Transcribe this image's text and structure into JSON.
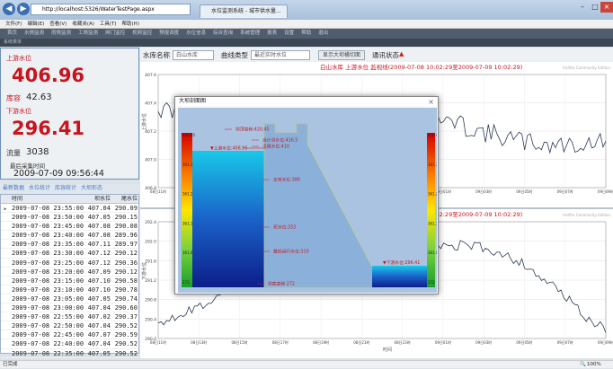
{
  "browser": {
    "address": "http://localhost:5326/WaterTestPage.aspx",
    "tab_label": "水位监测系统 - 城市供水量...",
    "back": "◀",
    "forward": "▶",
    "menu": [
      "文件(F)",
      "编辑(E)",
      "查看(V)",
      "收藏夹(A)",
      "工具(T)",
      "帮助(H)"
    ]
  },
  "app": {
    "nav": [
      "首页",
      "水情监测",
      "雨情监测",
      "工情监测",
      "闸门监控",
      "视频监控",
      "预报调度",
      "水位信息",
      "综合查询",
      "系统管理",
      "报表",
      "设置",
      "帮助",
      "退出"
    ],
    "subtitle": "系统菜单"
  },
  "left": {
    "upstream_label": "上游水位",
    "upstream_value": "406.96",
    "storage_label": "库容",
    "storage_value": "42.63",
    "downstream_label": "下游水位",
    "downstream_value": "296.41",
    "flow_label": "流量",
    "flow_value": "3038",
    "last_time_label": "最后采集时间",
    "last_time_value": "2009-07-09 09:56:44"
  },
  "table": {
    "tabs": [
      "最新数据",
      "水位统计",
      "库容统计",
      "大坝形态"
    ],
    "headers": [
      "时间",
      "坝水位",
      "尾水位"
    ],
    "rows": [
      [
        "2009-07-08 23:55:00",
        "407.04",
        "290.09"
      ],
      [
        "2009-07-08 23:50:00",
        "407.05",
        "290.15"
      ],
      [
        "2009-07-08 23:45:00",
        "407.08",
        "290.08"
      ],
      [
        "2009-07-08 23:40:00",
        "407.08",
        "289.96"
      ],
      [
        "2009-07-08 23:35:00",
        "407.11",
        "289.97"
      ],
      [
        "2009-07-08 23:30:00",
        "407.12",
        "290.12"
      ],
      [
        "2009-07-08 23:25:00",
        "407.12",
        "290.36"
      ],
      [
        "2009-07-08 23:20:00",
        "407.09",
        "290.12"
      ],
      [
        "2009-07-08 23:15:00",
        "407.10",
        "290.58"
      ],
      [
        "2009-07-08 23:10:00",
        "407.10",
        "290.78"
      ],
      [
        "2009-07-08 23:05:00",
        "407.05",
        "290.74"
      ],
      [
        "2009-07-08 23:00:00",
        "407.04",
        "290.60"
      ],
      [
        "2009-07-08 22:55:00",
        "407.02",
        "290.37"
      ],
      [
        "2009-07-08 22:50:00",
        "407.04",
        "290.52"
      ],
      [
        "2009-07-08 22:45:00",
        "407.07",
        "290.59"
      ],
      [
        "2009-07-08 22:40:00",
        "407.04",
        "290.52"
      ],
      [
        "2009-07-08 22:35:00",
        "407.05",
        "290.52"
      ]
    ]
  },
  "toolbar": {
    "reservoir_label": "水库名称",
    "reservoir_value": "白山水库",
    "curve_label": "曲线类型",
    "curve_value": "最近实时水位",
    "show_dam_button": "显示大坝横切面",
    "comm_label": "通讯状态",
    "comm_icon": "▲"
  },
  "charts": {
    "upper_title": "白山水库 上游水位 监视线(2009-07-08 10:02:29至2009-07-09 10:02:29)",
    "upper_ylabel": "上游水位",
    "upper_yticks": [
      "407.6",
      "407.4",
      "407.2",
      "407.0",
      "406.8"
    ],
    "lower_title": "白山水库 下游水位 监视线(2009-07-08 10:02:29至2009-07-09 10:02:29)",
    "lower_ylabel": "下游水位",
    "lower_yticks": [
      "292.4",
      "292.0",
      "291.6",
      "291.2",
      "290.8",
      "290.4",
      "290.0"
    ],
    "xticks": [
      "08日11时",
      "08日13时",
      "08日15时",
      "08日17时",
      "08日19时",
      "08日21时",
      "08日23时",
      "09日01时",
      "09日03时",
      "09日05时",
      "09日07时",
      "09日09时"
    ],
    "xlabel": "时间",
    "watermark": "Visifire Community Edition"
  },
  "popup": {
    "title": "大坝剖面图",
    "close_icon": "×",
    "labels": {
      "crest": "坝顶高程:420.45",
      "design": "设计洪水位:416.5",
      "flood_limit": "汛限水位:410",
      "upstream": "▼上游水位:406.96",
      "normal": "正常水位:380",
      "dead": "死水位:333",
      "min_run": "最低运行水位:310",
      "bottom": "坝底高程:272",
      "downstream": "▼下游水位:296.41"
    },
    "left_scale": [
      "420.45",
      "361.3",
      "361.2",
      "361.1",
      "361.0",
      "272"
    ],
    "right_scale": [
      "420.45",
      "361.3",
      "361.2",
      "361.1",
      "361.0",
      "272"
    ]
  },
  "status": {
    "left": "已完成",
    "zoom": "100%"
  }
}
